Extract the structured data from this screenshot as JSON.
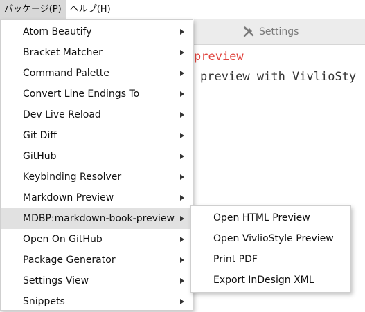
{
  "menubar": {
    "items": [
      {
        "label": "パッケージ(P)"
      },
      {
        "label": "ヘルプ(H)"
      }
    ]
  },
  "editor": {
    "tab_label": "Settings",
    "tab_icon": "tools-icon",
    "line1": "preview",
    "line2": "preview with VivlioSty"
  },
  "package_menu": {
    "items": [
      {
        "label": "Atom Beautify"
      },
      {
        "label": "Bracket Matcher"
      },
      {
        "label": "Command Palette"
      },
      {
        "label": "Convert Line Endings To"
      },
      {
        "label": "Dev Live Reload"
      },
      {
        "label": "Git Diff"
      },
      {
        "label": "GitHub"
      },
      {
        "label": "Keybinding Resolver"
      },
      {
        "label": "Markdown Preview"
      },
      {
        "label": "MDBP:markdown-book-preview"
      },
      {
        "label": "Open On GitHub"
      },
      {
        "label": "Package Generator"
      },
      {
        "label": "Settings View"
      },
      {
        "label": "Snippets"
      }
    ]
  },
  "submenu": {
    "items": [
      {
        "label": "Open HTML Preview"
      },
      {
        "label": "Open VivlioStyle Preview"
      },
      {
        "label": "Print PDF"
      },
      {
        "label": "Export InDesign XML"
      }
    ]
  },
  "colors": {
    "highlight": "#e1e1e1",
    "code_red": "#e0443e"
  }
}
